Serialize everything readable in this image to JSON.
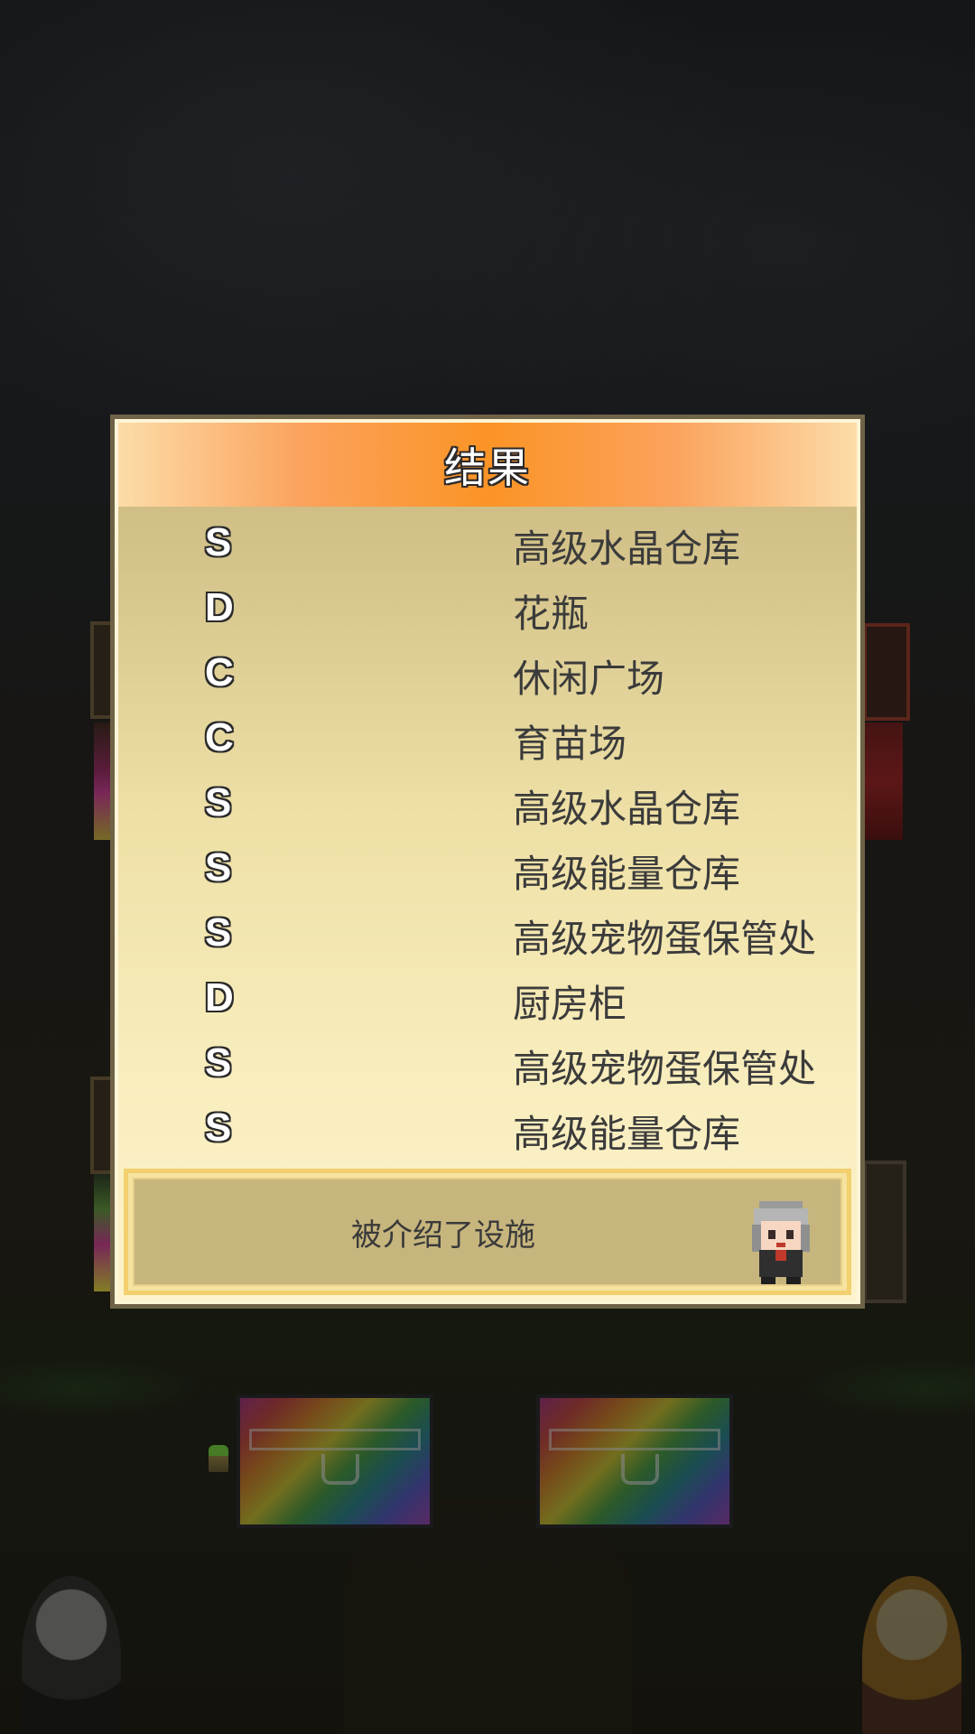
{
  "dialog": {
    "title": "结果",
    "results": [
      {
        "rank": "S",
        "facility": "高级水晶仓库"
      },
      {
        "rank": "D",
        "facility": "花瓶"
      },
      {
        "rank": "C",
        "facility": "休闲广场"
      },
      {
        "rank": "C",
        "facility": "育苗场"
      },
      {
        "rank": "S",
        "facility": "高级水晶仓库"
      },
      {
        "rank": "S",
        "facility": "高级能量仓库"
      },
      {
        "rank": "S",
        "facility": "高级宠物蛋保管处"
      },
      {
        "rank": "D",
        "facility": "厨房柜"
      },
      {
        "rank": "S",
        "facility": "高级宠物蛋保管处"
      },
      {
        "rank": "S",
        "facility": "高级能量仓库"
      }
    ],
    "message": "被介绍了设施"
  },
  "colors": {
    "header_center": "#fb9426",
    "header_edge": "#fcdca8",
    "dialog_border": "#6f6347",
    "message_box_border": "#f2d06e",
    "message_box_fill": "#c6b57d",
    "text_dark": "#3b3b3b"
  },
  "icons": {
    "speaker": "elderly-character-sprite-icon",
    "chests": "rainbow-treasure-chest-icon"
  }
}
